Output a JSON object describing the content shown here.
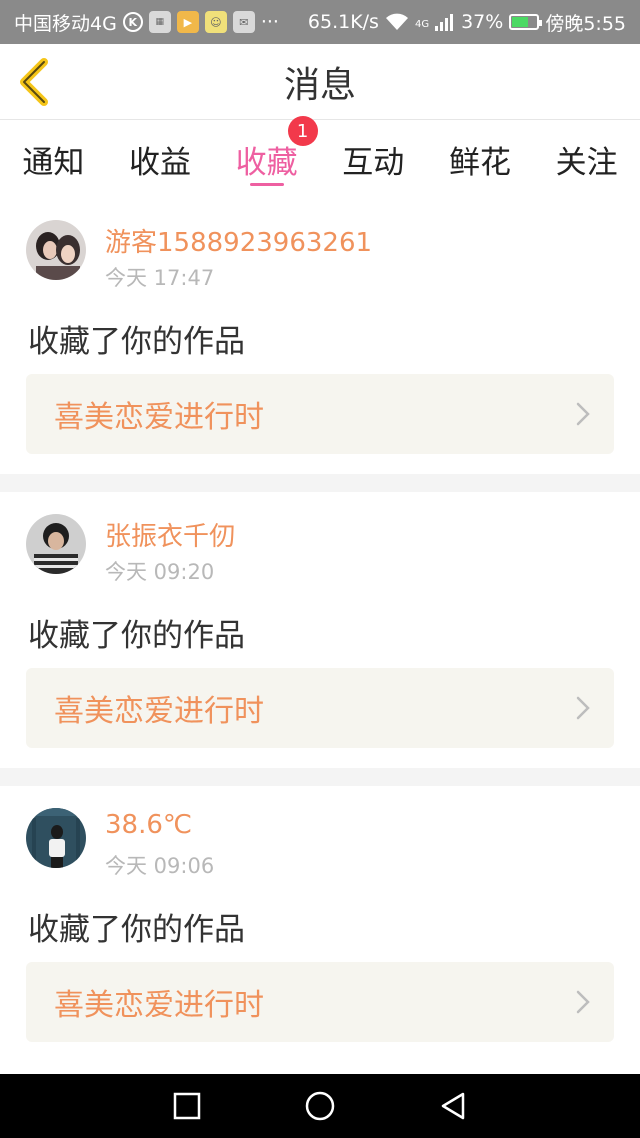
{
  "status_bar": {
    "carrier": "中国移动4G",
    "network_speed": "65.1K/s",
    "signal_type": "4G",
    "battery": "37%",
    "time": "傍晚5:55",
    "app_icons": [
      "k-circle-icon",
      "app-box-icon",
      "video-icon",
      "chat-icon",
      "mail-icon"
    ],
    "more": "···"
  },
  "header": {
    "title": "消息"
  },
  "tabs": [
    {
      "label": "通知",
      "active": false
    },
    {
      "label": "收益",
      "active": false
    },
    {
      "label": "收藏",
      "active": true,
      "badge": "1"
    },
    {
      "label": "互动",
      "active": false
    },
    {
      "label": "鲜花",
      "active": false
    },
    {
      "label": "关注",
      "active": false
    }
  ],
  "messages": [
    {
      "username": "游客1588923963261",
      "time": "今天 17:47",
      "action": "收藏了你的作品",
      "work_title": "喜美恋爱进行时"
    },
    {
      "username": "张振衣千仞",
      "time": "今天 09:20",
      "action": "收藏了你的作品",
      "work_title": "喜美恋爱进行时"
    },
    {
      "username": "38.6℃",
      "time": "今天 09:06",
      "action": "收藏了你的作品",
      "work_title": "喜美恋爱进行时"
    }
  ],
  "colors": {
    "accent_pink": "#ee5fa1",
    "username_orange": "#f0925c",
    "badge_red": "#f2394b",
    "back_yellow": "#f5c518",
    "card_bg": "#f6f5ef"
  }
}
